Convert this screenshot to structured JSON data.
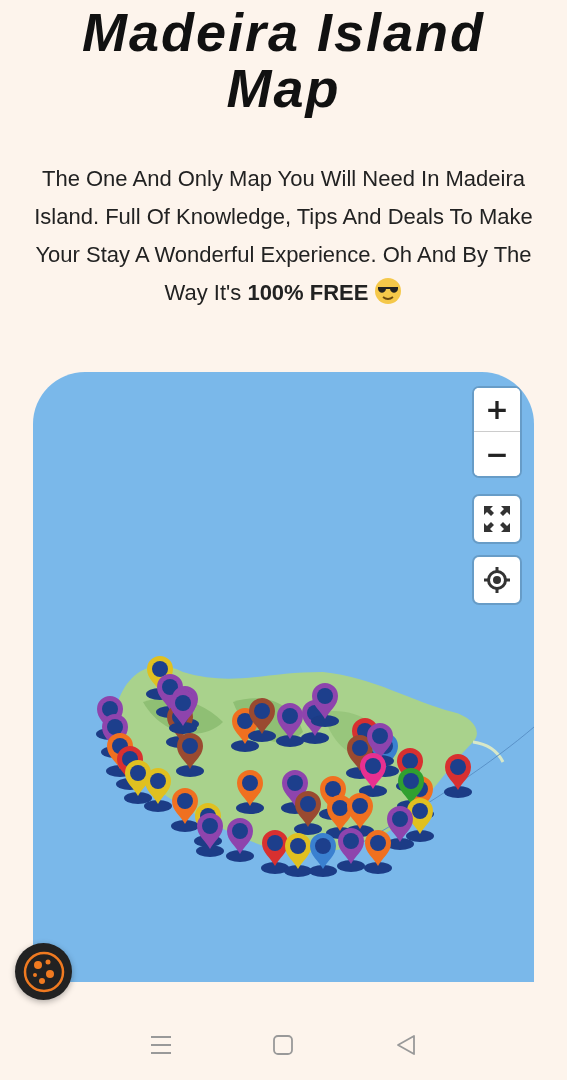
{
  "title": "Madeira Island Map",
  "intro": "The One And Only Map You Will Need In Madeira Island. Full Of Knowledge, Tips And Deals To Make Your Stay A Wonderful Experience. Oh And By The Way It's **100% FREE**",
  "map": {
    "zoom_in": "+",
    "zoom_out": "−"
  }
}
